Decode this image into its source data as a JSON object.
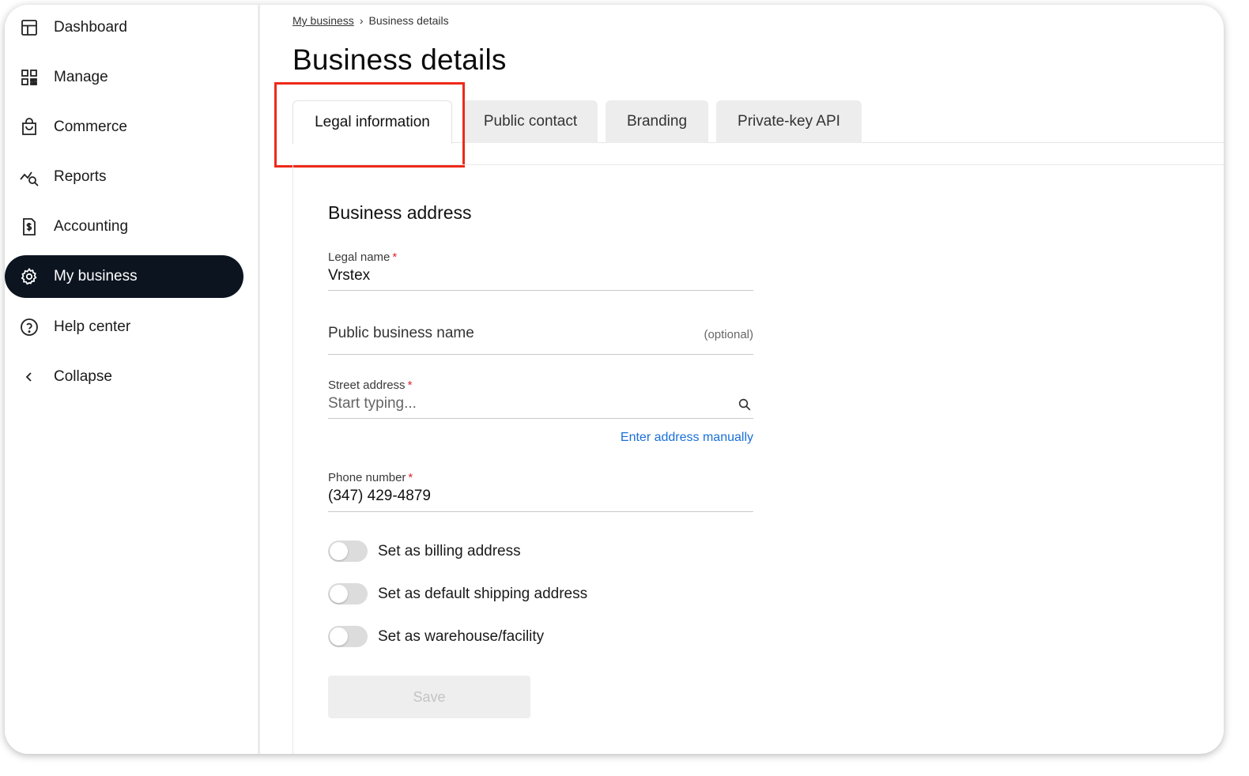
{
  "sidebar": {
    "items": [
      {
        "label": "Dashboard",
        "icon": "dashboard-icon"
      },
      {
        "label": "Manage",
        "icon": "qr-grid-icon"
      },
      {
        "label": "Commerce",
        "icon": "shopping-bag-icon"
      },
      {
        "label": "Reports",
        "icon": "chart-search-icon"
      },
      {
        "label": "Accounting",
        "icon": "invoice-dollar-icon"
      },
      {
        "label": "My business",
        "icon": "gear-icon",
        "active": true
      },
      {
        "label": "Help center",
        "icon": "help-circle-icon"
      },
      {
        "label": "Collapse",
        "icon": "chevron-left-icon"
      }
    ]
  },
  "breadcrumb": {
    "parent": "My business",
    "separator": "›",
    "current": "Business details"
  },
  "page": {
    "title": "Business details"
  },
  "tabs": [
    {
      "label": "Legal information",
      "active": true
    },
    {
      "label": "Public contact"
    },
    {
      "label": "Branding"
    },
    {
      "label": "Private-key API"
    }
  ],
  "form": {
    "section_title": "Business address",
    "legal_name": {
      "label": "Legal name",
      "required_mark": "*",
      "value": "Vrstex"
    },
    "public_name": {
      "label": "Public business name",
      "optional": "(optional)"
    },
    "street": {
      "label": "Street address",
      "required_mark": "*",
      "placeholder": "Start typing..."
    },
    "enter_manually": "Enter address manually",
    "phone": {
      "label": "Phone number",
      "required_mark": "*",
      "value": "(347) 429-4879"
    },
    "toggles": [
      {
        "label": "Set as billing address",
        "on": false
      },
      {
        "label": "Set as default shipping address",
        "on": false
      },
      {
        "label": "Set as warehouse/facility",
        "on": false
      }
    ],
    "save_label": "Save"
  },
  "colors": {
    "active_nav_bg": "#0c1420",
    "highlight_border": "#ee2a19",
    "link": "#1a6fd8",
    "required": "#e0242f"
  }
}
